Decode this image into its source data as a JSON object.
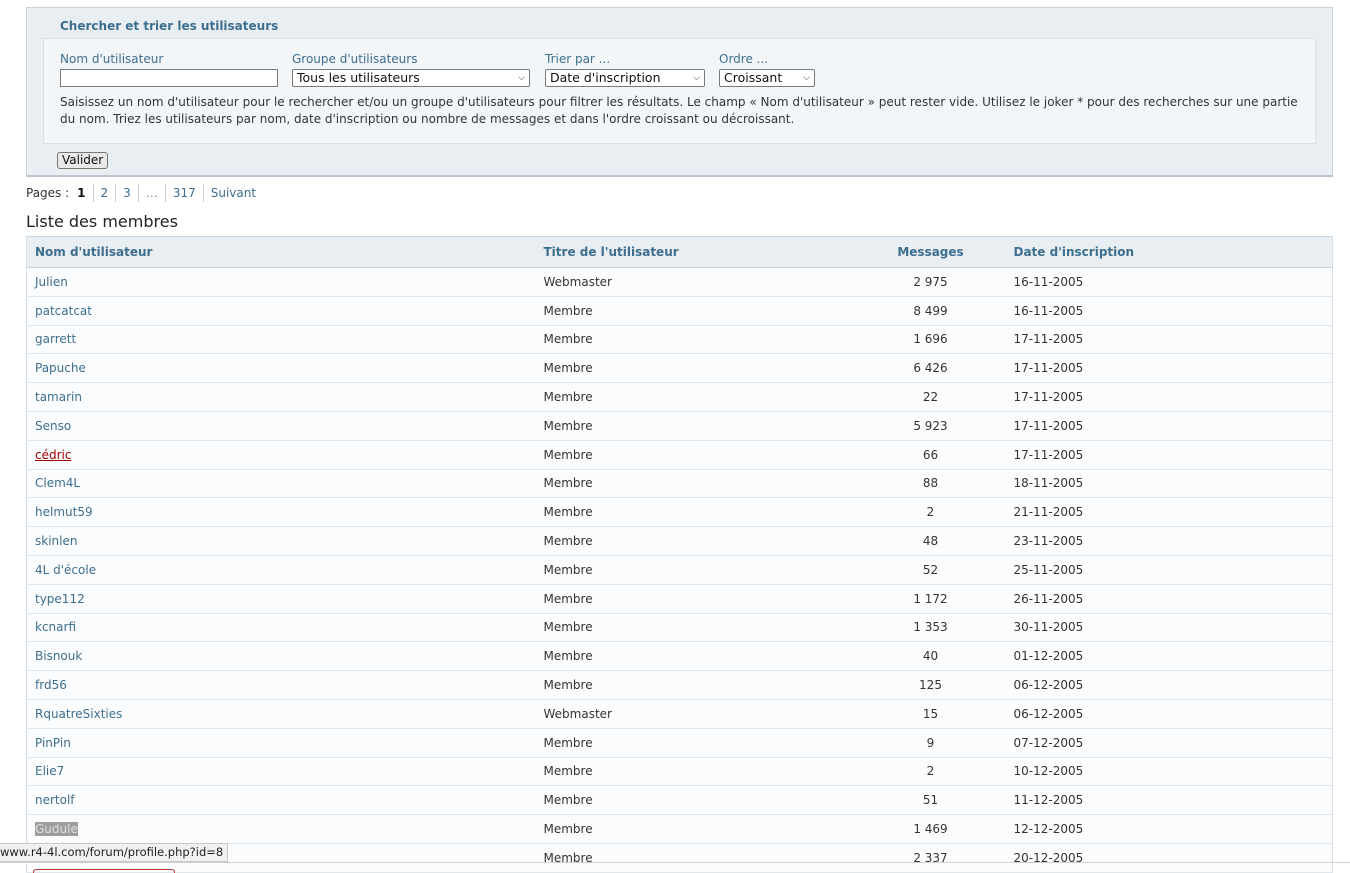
{
  "search": {
    "title": "Chercher et trier les utilisateurs",
    "username_label": "Nom d'utilisateur",
    "username_value": "",
    "group_label": "Groupe d'utilisateurs",
    "group_value": "Tous les utilisateurs",
    "sort_label": "Trier par ...",
    "sort_value": "Date d'inscription",
    "order_label": "Ordre ...",
    "order_value": "Croissant",
    "help": "Saisissez un nom d'utilisateur pour le rechercher et/ou un groupe d'utilisateurs pour filtrer les résultats. Le champ « Nom d'utilisateur » peut rester vide. Utilisez le joker * pour des recherches sur une partie du nom. Triez les utilisateurs par nom, date d'inscription ou nombre de messages et dans l'ordre croissant ou décroissant.",
    "submit_label": "Valider"
  },
  "pagination": {
    "label": "Pages :",
    "pages": [
      "1",
      "2",
      "3",
      "…",
      "317",
      "Suivant"
    ],
    "current": "1"
  },
  "list": {
    "title": "Liste des membres",
    "columns": [
      "Nom d'utilisateur",
      "Titre de l'utilisateur",
      "Messages",
      "Date d'inscription"
    ],
    "rows": [
      {
        "user": "Julien",
        "title": "Webmaster",
        "messages": "2 975",
        "date": "16-11-2005"
      },
      {
        "user": "patcatcat",
        "title": "Membre",
        "messages": "8 499",
        "date": "16-11-2005"
      },
      {
        "user": "garrett",
        "title": "Membre",
        "messages": "1 696",
        "date": "17-11-2005"
      },
      {
        "user": "Papuche",
        "title": "Membre",
        "messages": "6 426",
        "date": "17-11-2005"
      },
      {
        "user": "tamarin",
        "title": "Membre",
        "messages": "22",
        "date": "17-11-2005"
      },
      {
        "user": "Senso",
        "title": "Membre",
        "messages": "5 923",
        "date": "17-11-2005"
      },
      {
        "user": "cédric",
        "title": "Membre",
        "messages": "66",
        "date": "17-11-2005"
      },
      {
        "user": "Clem4L",
        "title": "Membre",
        "messages": "88",
        "date": "18-11-2005"
      },
      {
        "user": "helmut59",
        "title": "Membre",
        "messages": "2",
        "date": "21-11-2005"
      },
      {
        "user": "skinlen",
        "title": "Membre",
        "messages": "48",
        "date": "23-11-2005"
      },
      {
        "user": "4L d'école",
        "title": "Membre",
        "messages": "52",
        "date": "25-11-2005"
      },
      {
        "user": "type112",
        "title": "Membre",
        "messages": "1 172",
        "date": "26-11-2005"
      },
      {
        "user": "kcnarfi",
        "title": "Membre",
        "messages": "1 353",
        "date": "30-11-2005"
      },
      {
        "user": "Bisnouk",
        "title": "Membre",
        "messages": "40",
        "date": "01-12-2005"
      },
      {
        "user": "frd56",
        "title": "Membre",
        "messages": "125",
        "date": "06-12-2005"
      },
      {
        "user": "RquatreSixties",
        "title": "Webmaster",
        "messages": "15",
        "date": "06-12-2005"
      },
      {
        "user": "PinPin",
        "title": "Membre",
        "messages": "9",
        "date": "07-12-2005"
      },
      {
        "user": "Elie7",
        "title": "Membre",
        "messages": "2",
        "date": "10-12-2005"
      },
      {
        "user": "nertolf",
        "title": "Membre",
        "messages": "51",
        "date": "11-12-2005"
      },
      {
        "user": "Gudule",
        "title": "Membre",
        "messages": "1 469",
        "date": "12-12-2005"
      },
      {
        "user": "",
        "title": "Membre",
        "messages": "2 337",
        "date": "20-12-2005"
      }
    ]
  },
  "status_bar": {
    "url": "www.r4-4l.com/forum/profile.php?id=8"
  },
  "colors": {
    "link": "#3e6f8f",
    "visited_link": "#a00000",
    "panel_bg": "#e9eef3"
  }
}
